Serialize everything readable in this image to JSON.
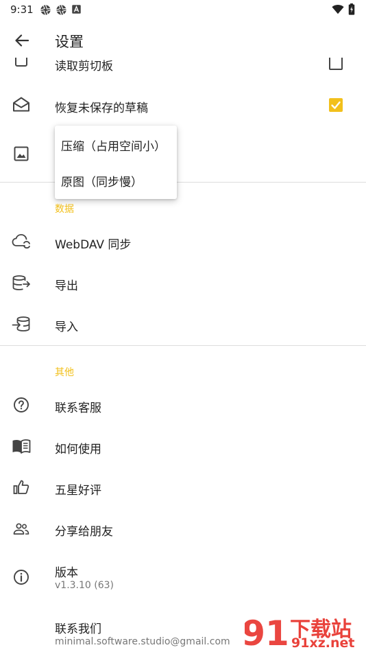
{
  "status_bar": {
    "time": "9:31"
  },
  "app_bar": {
    "title": "设置"
  },
  "settings": {
    "read_clipboard": {
      "label": "读取剪切板",
      "checked": false
    },
    "restore_drafts": {
      "label": "恢复未保存的草稿",
      "checked": true
    }
  },
  "image_popup": {
    "options": [
      "压缩（占用空间小）",
      "原图（同步慢）"
    ]
  },
  "data_section": {
    "header": "数据",
    "items": [
      "WebDAV 同步",
      "导出",
      "导入"
    ]
  },
  "other_section": {
    "header": "其他",
    "items": [
      "联系客服",
      "如何使用",
      "五星好评",
      "分享给朋友"
    ],
    "version": {
      "label": "版本",
      "value": "v1.3.10 (63)"
    },
    "contact": {
      "label": "联系我们",
      "value": "minimal.software.studio@gmail.com"
    }
  },
  "watermark": {
    "text_cn": "下载站",
    "text_url": "91xz.net",
    "logo": "91"
  },
  "colors": {
    "accent": "#f2c01c",
    "watermark_red": "#e8322b"
  }
}
